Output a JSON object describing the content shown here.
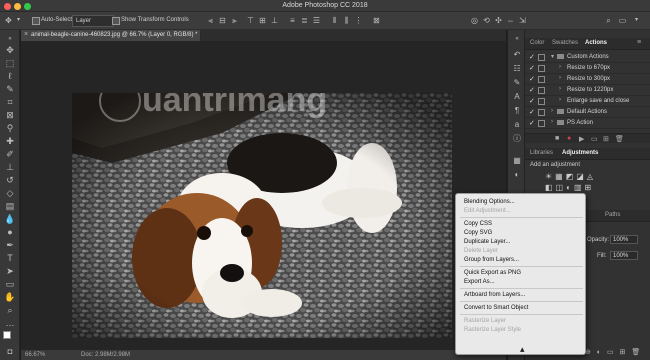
{
  "app": {
    "title": "Adobe Photoshop CC 2018"
  },
  "options_bar": {
    "auto_select_label": "Auto-Select:",
    "auto_select_value": "Layer",
    "transform_controls_label": "Show Transform Controls"
  },
  "document": {
    "tab_label": "animal-beagle-canine-460823.jpg @ 66.7% (Layer 0, RGB/8) *",
    "watermark_text": "uantrimang"
  },
  "status_bar": {
    "zoom": "66.67%",
    "doc_size": "Doc: 2.98M/2.98M"
  },
  "panels": {
    "top_tabs": [
      "Color",
      "Swatches",
      "Actions"
    ],
    "actions": [
      {
        "label": "Custom Actions",
        "checked": true
      },
      {
        "label": "Resize to 670px",
        "checked": true
      },
      {
        "label": "Resize to 300px",
        "checked": true
      },
      {
        "label": "Resize to 1220px",
        "checked": true
      },
      {
        "label": "Enlarge save and close",
        "checked": true
      },
      {
        "label": "Default Actions",
        "checked": true
      },
      {
        "label": "PS Action",
        "checked": true
      }
    ],
    "mid_tabs": [
      "Libraries",
      "Adjustments"
    ],
    "adjustments_hint": "Add an adjustment",
    "layers_tab": "Paths",
    "opacity_label": "Opacity:",
    "opacity_value": "100%",
    "fill_label": "Fill:",
    "fill_value": "100%"
  },
  "context_menu": {
    "items": [
      {
        "label": "Blending Options...",
        "disabled": false
      },
      {
        "label": "Edit Adjustment...",
        "disabled": true
      },
      {
        "label": "Copy CSS",
        "disabled": false
      },
      {
        "label": "Copy SVG",
        "disabled": false
      },
      {
        "label": "Duplicate Layer...",
        "disabled": false
      },
      {
        "label": "Delete Layer",
        "disabled": true
      },
      {
        "label": "Group from Layers...",
        "disabled": false
      },
      {
        "label": "Quick Export as PNG",
        "disabled": false
      },
      {
        "label": "Export As...",
        "disabled": false
      },
      {
        "label": "Artboard from Layers...",
        "disabled": false
      },
      {
        "label": "Convert to Smart Object",
        "disabled": false
      },
      {
        "label": "Rasterize Layer",
        "disabled": true
      },
      {
        "label": "Rasterize Layer Style",
        "disabled": true
      }
    ]
  }
}
